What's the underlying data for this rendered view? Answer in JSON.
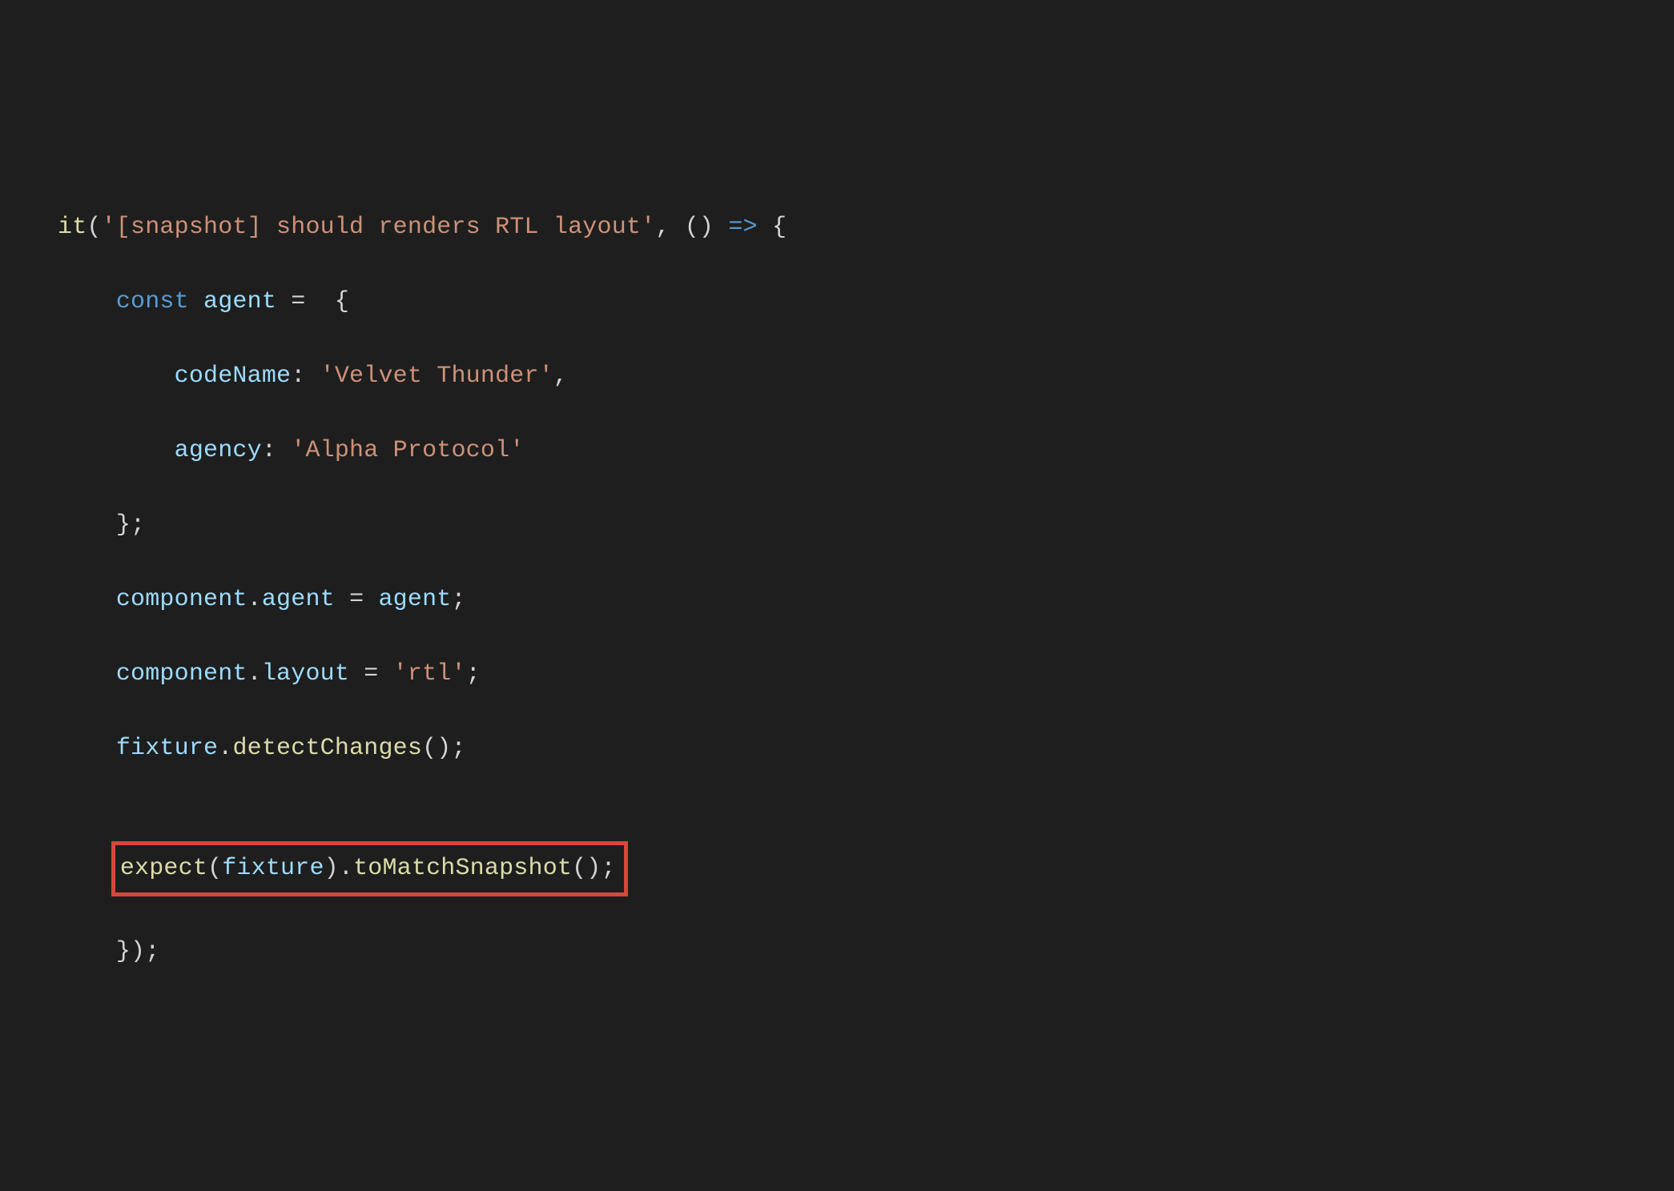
{
  "code": {
    "line1": {
      "fn": "it",
      "paren_open": "(",
      "str": "'[snapshot] should renders RTL layout'",
      "comma_sp": ", ",
      "args": "()",
      "sp": " ",
      "arrow": "=>",
      "sp2": " ",
      "brace": "{"
    },
    "line2": {
      "indent": "    ",
      "kw": "const",
      "sp": " ",
      "var": "agent",
      "sp2": " ",
      "eq": "=",
      "sp3": "  ",
      "brace": "{"
    },
    "line3": {
      "indent": "        ",
      "prop": "codeName",
      "colon": ":",
      "sp": " ",
      "val": "'Velvet Thunder'",
      "comma": ","
    },
    "line4": {
      "indent": "        ",
      "prop": "agency",
      "colon": ":",
      "sp": " ",
      "val": "'Alpha Protocol'"
    },
    "line5": {
      "indent": "    ",
      "close": "};"
    },
    "line6": {
      "indent": "    ",
      "obj": "component",
      "dot": ".",
      "prop": "agent",
      "sp": " ",
      "eq": "=",
      "sp2": " ",
      "val": "agent",
      "semi": ";"
    },
    "line7": {
      "indent": "    ",
      "obj": "component",
      "dot": ".",
      "prop": "layout",
      "sp": " ",
      "eq": "=",
      "sp2": " ",
      "val": "'rtl'",
      "semi": ";"
    },
    "line8": {
      "indent": "    ",
      "obj": "fixture",
      "dot": ".",
      "fn": "detectChanges",
      "call": "();"
    },
    "line9": "",
    "line10": {
      "indent": "    ",
      "fn": "expect",
      "paren_open": "(",
      "arg": "fixture",
      "paren_close": ")",
      "dot": ".",
      "fn2": "toMatchSnapshot",
      "call": "();"
    },
    "line11": {
      "indent": "    ",
      "close": "});"
    }
  }
}
